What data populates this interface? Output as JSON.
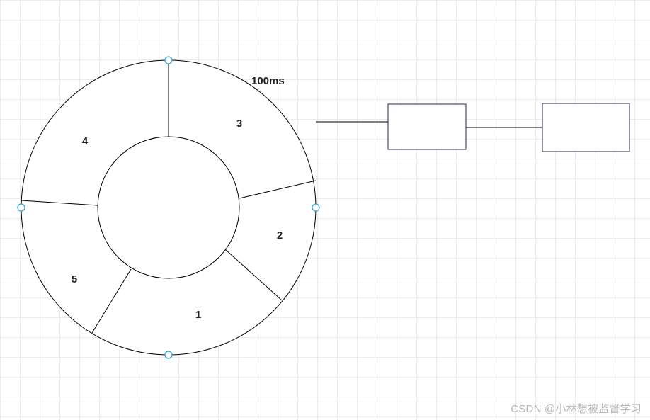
{
  "diagram": {
    "annotation": "100ms",
    "sectors": {
      "s1": "1",
      "s2": "2",
      "s3": "3",
      "s4": "4",
      "s5": "5"
    }
  },
  "watermark": "CSDN @小林想被监督学习"
}
